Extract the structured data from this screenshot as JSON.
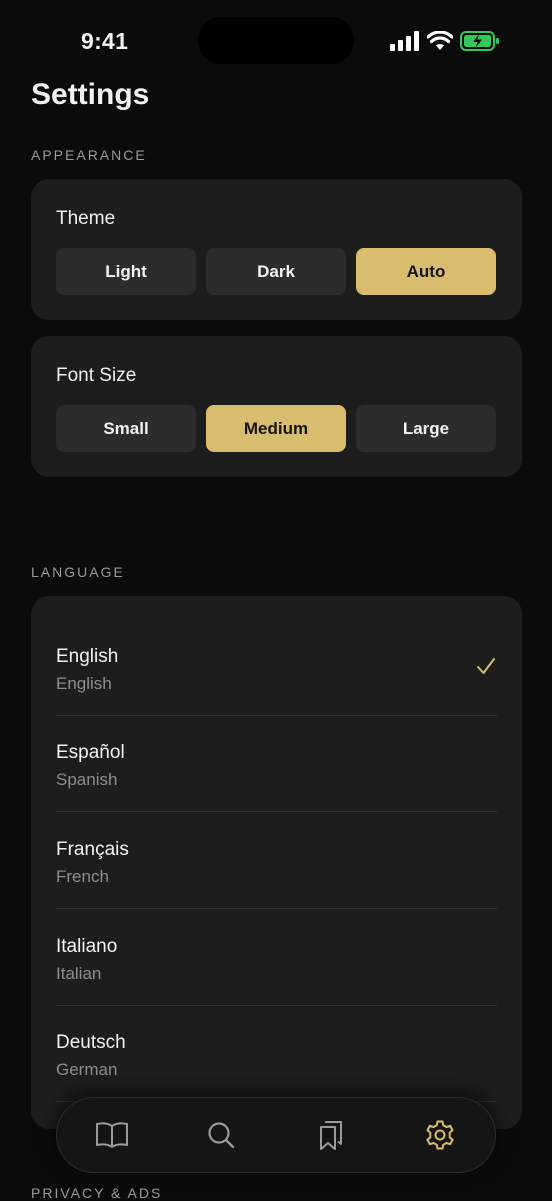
{
  "status_bar": {
    "time": "9:41"
  },
  "header": {
    "title": "Settings"
  },
  "appearance": {
    "section_label": "APPEARANCE",
    "theme": {
      "title": "Theme",
      "options": [
        "Light",
        "Dark",
        "Auto"
      ],
      "selected": "Auto"
    },
    "font_size": {
      "title": "Font Size",
      "options": [
        "Small",
        "Medium",
        "Large"
      ],
      "selected": "Medium"
    }
  },
  "language": {
    "section_label": "LANGUAGE",
    "items": [
      {
        "name": "English",
        "sub": "English",
        "selected": true
      },
      {
        "name": "Español",
        "sub": "Spanish",
        "selected": false
      },
      {
        "name": "Français",
        "sub": "French",
        "selected": false
      },
      {
        "name": "Italiano",
        "sub": "Italian",
        "selected": false
      },
      {
        "name": "Deutsch",
        "sub": "German",
        "selected": false
      }
    ]
  },
  "privacy": {
    "section_label": "PRIVACY & ADS"
  },
  "tab_bar": {
    "tabs": [
      {
        "icon": "book-open-icon",
        "active": false
      },
      {
        "icon": "search-icon",
        "active": false
      },
      {
        "icon": "bookmarks-icon",
        "active": false
      },
      {
        "icon": "gear-icon",
        "active": true
      }
    ]
  },
  "colors": {
    "accent": "#d9bd6f",
    "background": "#0b0b0b",
    "card": "#1d1d1d",
    "battery": "#34c759"
  }
}
